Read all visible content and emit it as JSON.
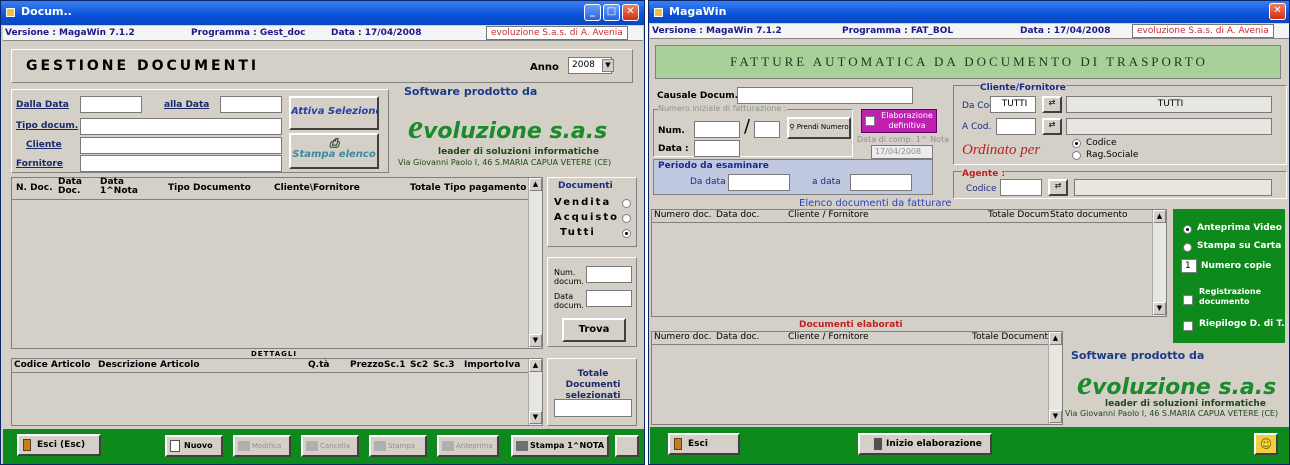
{
  "w1": {
    "title": "Docum..",
    "version": "Versione :  MagaWin 7.1.2",
    "program": "Programma : Gest_doc",
    "date": "Data :  17/04/2008",
    "brand": "evoluzione S.a.s. di A. Avenia",
    "heading": "GESTIONE  DOCUMENTI",
    "anno_label": "Anno",
    "anno_value": "2008",
    "filters": {
      "dalla_data": "Dalla Data",
      "alla_data": "alla Data",
      "tipo_docum": "Tipo docum.",
      "cliente": "Cliente",
      "fornitore": "Fornitore"
    },
    "attiva_selezione": "Attiva Selezione",
    "stampa_elenco": "Stampa elenco",
    "software_prodotto": "Software prodotto da",
    "evo_logo_e": "e",
    "evo_logo_rest": "voluzione   s.a.s",
    "evo_tagline": "leader di soluzioni informatiche",
    "evo_address": "Via Giovanni Paolo I, 46   S.MARIA CAPUA VETERE (CE)",
    "columns": [
      "N. Doc.",
      "Data Doc.",
      "Data 1^Nota",
      "Tipo Documento",
      "Cliente\\Fornitore",
      "Totale",
      "Tipo pagamento"
    ],
    "documenti": {
      "title": "Documenti",
      "vendita": "Vendita",
      "acquisto": "Acquisto",
      "tutti": "Tutti"
    },
    "num_docum": "Num. docum.",
    "data_docum": "Data docum.",
    "trova": "Trova",
    "dettagli": "DETTAGLI",
    "det_columns": [
      "Codice Articolo",
      "Descrizione Articolo",
      "Q.tà",
      "Prezzo",
      "Sc.1",
      "Sc2",
      "Sc.3",
      "Importo",
      "Iva"
    ],
    "totale_doc": "Totale Documenti selezionati",
    "buttons": {
      "esci": "Esci (Esc)",
      "nuovo": "Nuovo",
      "modifica": "Modifica",
      "cancella": "Cancella",
      "stampa": "Stampa",
      "anteprima": "Anteprima",
      "stampa_nota": "Stampa 1^NOTA"
    }
  },
  "w2": {
    "title": "MagaWin",
    "version": "Versione :  MagaWin 7.1.2",
    "program": "Programma : FAT_BOL",
    "date": "Data :  17/04/2008",
    "brand": "evoluzione S.a.s. di A. Avenia",
    "heading": "FATTURE AUTOMATICA DA DOCUMENTO DI TRASPORTO",
    "causale": "Causale Docum.:",
    "numero_iniziale": "Numero iniziale di fatturazione :",
    "num": "Num.",
    "data": "Data :",
    "slash": "/",
    "prendi_numero": "Prendi Numero",
    "elaborazione": "Elaborazione definitiva",
    "data_comp": "Data di comp. 1^ Nota",
    "data_comp_value": "17/04/2008",
    "periodo": "Periodo da esaminare",
    "da_data": "Da data",
    "a_data": "a data",
    "cliente_fornitore": "Cliente/Fornitore",
    "da_cod": "Da Cod.",
    "da_cod_value": "TUTTI",
    "da_desc_value": "TUTTI",
    "a_cod": "A  Cod.",
    "ordinato_per": "Ordinato per",
    "codice_opt": "Codice",
    "rag_sociale_opt": "Rag.Sociale",
    "agente": "Agente :",
    "codice": "Codice",
    "elenco_title": "Elenco documenti da fatturare",
    "elenco_cols": [
      "Numero doc.",
      "Data doc.",
      "Cliente / Fornitore",
      "Totale Docum",
      "Stato documento"
    ],
    "anteprima_video": "Anteprima Video",
    "stampa_carta": "Stampa su Carta",
    "numero_copie": "Numero copie",
    "numero_copie_value": "1",
    "registrazione": "Registrazione documento",
    "riepilogo": "Riepilogo D. di T.",
    "elaborati_title": "Documenti  elaborati",
    "elaborati_cols": [
      "Numero doc.",
      "Data doc.",
      "Cliente / Fornitore",
      "Totale Documento"
    ],
    "software_prodotto": "Software prodotto da",
    "evo_logo_e": "e",
    "evo_logo_rest": "voluzione   s.a.s",
    "evo_tagline": "leader di soluzioni informatiche",
    "evo_address": "Via Giovanni Paolo I, 46   S.MARIA CAPUA VETERE (CE)",
    "esci": "Esci",
    "inizio": "Inizio elaborazione"
  },
  "colors": {
    "green": "#0e8a1c",
    "title_blue": "#0a52d8",
    "logo_green": "#1a8a2a",
    "magenta": "#c020b0",
    "ordinato_red": "#c02020"
  }
}
